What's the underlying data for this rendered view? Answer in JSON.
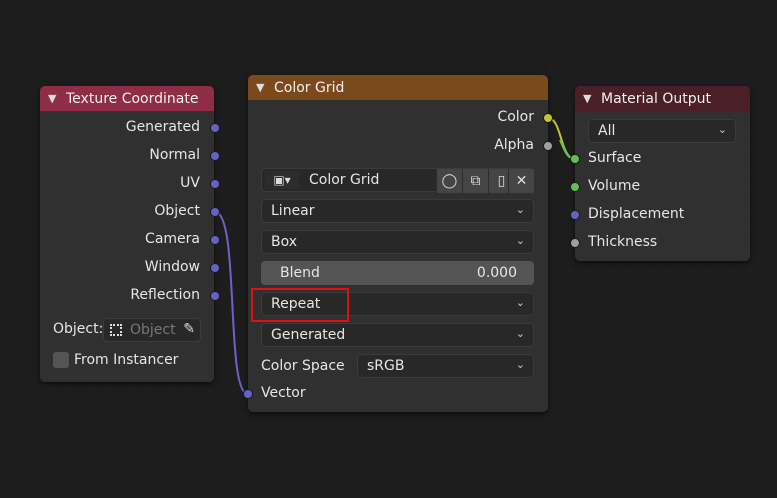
{
  "texture_coordinate": {
    "title": "Texture Coordinate",
    "outputs": [
      "Generated",
      "Normal",
      "UV",
      "Object",
      "Camera",
      "Window",
      "Reflection"
    ],
    "object_label": "Object:",
    "object_placeholder": "Object",
    "from_instancer_label": "From Instancer",
    "header_color": "#8e2d45",
    "socket_color": "#6363c7"
  },
  "color_grid": {
    "title": "Color Grid",
    "output_color": "Color",
    "output_alpha": "Alpha",
    "image_name": "Color Grid",
    "interpolation": "Linear",
    "projection": "Box",
    "blend_label": "Blend",
    "blend_value": "0.000",
    "extension": "Repeat",
    "source": "Generated",
    "color_space_label": "Color Space",
    "color_space_value": "sRGB",
    "input_vector": "Vector",
    "header_color": "#7a4a1d",
    "highlight_color": "#e01010"
  },
  "material_output": {
    "title": "Material Output",
    "target": "All",
    "inputs": [
      "Surface",
      "Volume",
      "Displacement",
      "Thickness"
    ],
    "header_color": "#4a1f28"
  },
  "icons": [
    "chevron-down-icon",
    "image-icon",
    "shield-icon",
    "duplicate-icon",
    "folder-icon",
    "close-icon",
    "object-icon",
    "eyedropper-icon"
  ]
}
